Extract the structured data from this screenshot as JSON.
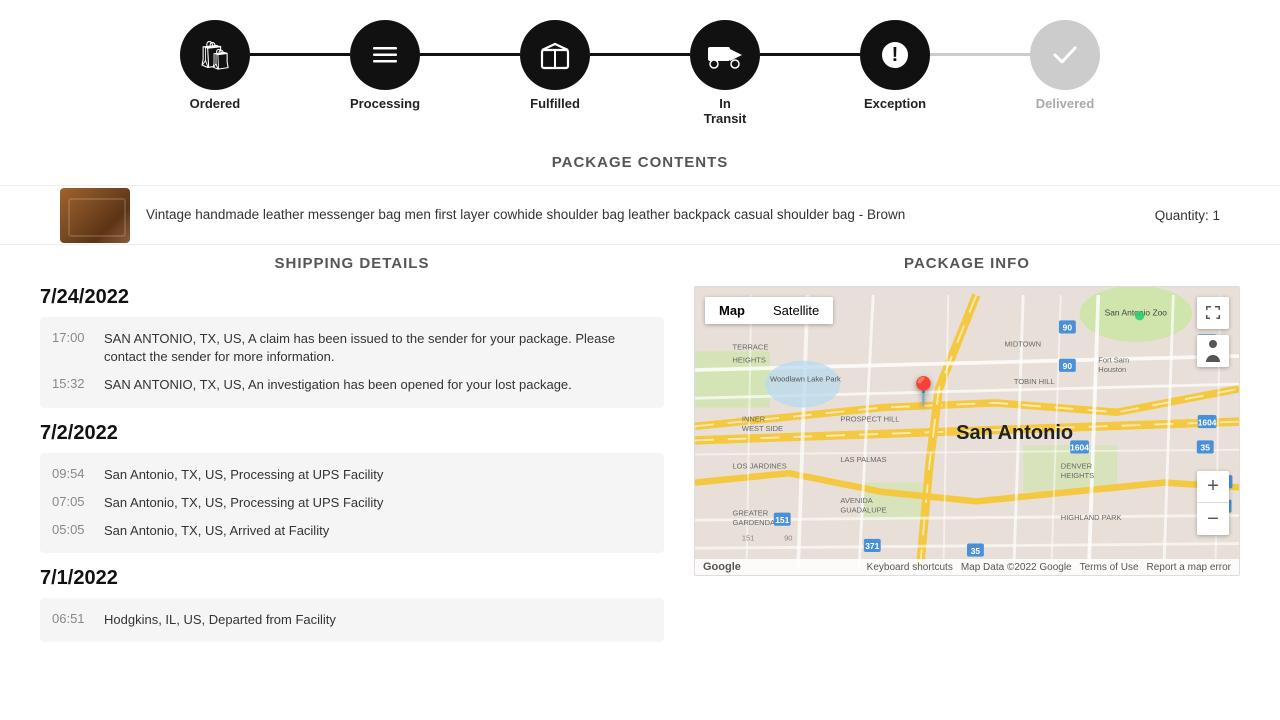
{
  "progress": {
    "steps": [
      {
        "id": "ordered",
        "label": "Ordered",
        "icon": "🛍",
        "active": true,
        "connector": true,
        "connector_active": true
      },
      {
        "id": "processing",
        "label": "Processing",
        "icon": "☰",
        "active": true,
        "connector": true,
        "connector_active": true
      },
      {
        "id": "fulfilled",
        "label": "Fulfilled",
        "icon": "📦",
        "active": true,
        "connector": true,
        "connector_active": true
      },
      {
        "id": "in-transit",
        "label": "In Transit",
        "icon": "🚚",
        "active": true,
        "connector": true,
        "connector_active": true
      },
      {
        "id": "exception",
        "label": "Exception",
        "icon": "⚠",
        "active": true,
        "connector": true,
        "connector_active": false
      },
      {
        "id": "delivered",
        "label": "Delivered",
        "icon": "✓",
        "active": false,
        "connector": false
      }
    ]
  },
  "package_contents": {
    "title": "PACKAGE CONTENTS",
    "item_description": "Vintage handmade leather messenger bag men first layer cowhide shoulder bag leather backpack casual shoulder bag - Brown",
    "quantity_label": "Quantity:",
    "quantity": "1"
  },
  "shipping_details": {
    "title": "SHIPPING DETAILS",
    "date_groups": [
      {
        "date": "7/24/2022",
        "events": [
          {
            "time": "17:00",
            "description": "SAN ANTONIO, TX, US, A claim has been issued to the sender for your package. Please contact the sender for more information."
          },
          {
            "time": "15:32",
            "description": "SAN ANTONIO, TX, US, An investigation has been opened for your lost package."
          }
        ]
      },
      {
        "date": "7/2/2022",
        "events": [
          {
            "time": "09:54",
            "description": "San Antonio, TX, US, Processing at UPS Facility"
          },
          {
            "time": "07:05",
            "description": "San Antonio, TX, US, Processing at UPS Facility"
          },
          {
            "time": "05:05",
            "description": "San Antonio, TX, US, Arrived at Facility"
          }
        ]
      },
      {
        "date": "7/1/2022",
        "events": [
          {
            "time": "06:51",
            "description": "Hodgkins, IL, US, Departed from Facility"
          }
        ]
      }
    ]
  },
  "package_info": {
    "title": "PACKAGE INFO",
    "map": {
      "city": "San Antonio",
      "tabs": [
        "Map",
        "Satellite"
      ],
      "active_tab": "Map",
      "footer": {
        "google_logo": "Google",
        "links": [
          "Keyboard shortcuts",
          "Map Data ©2022 Google",
          "Terms of Use",
          "Report a map error"
        ]
      }
    }
  }
}
